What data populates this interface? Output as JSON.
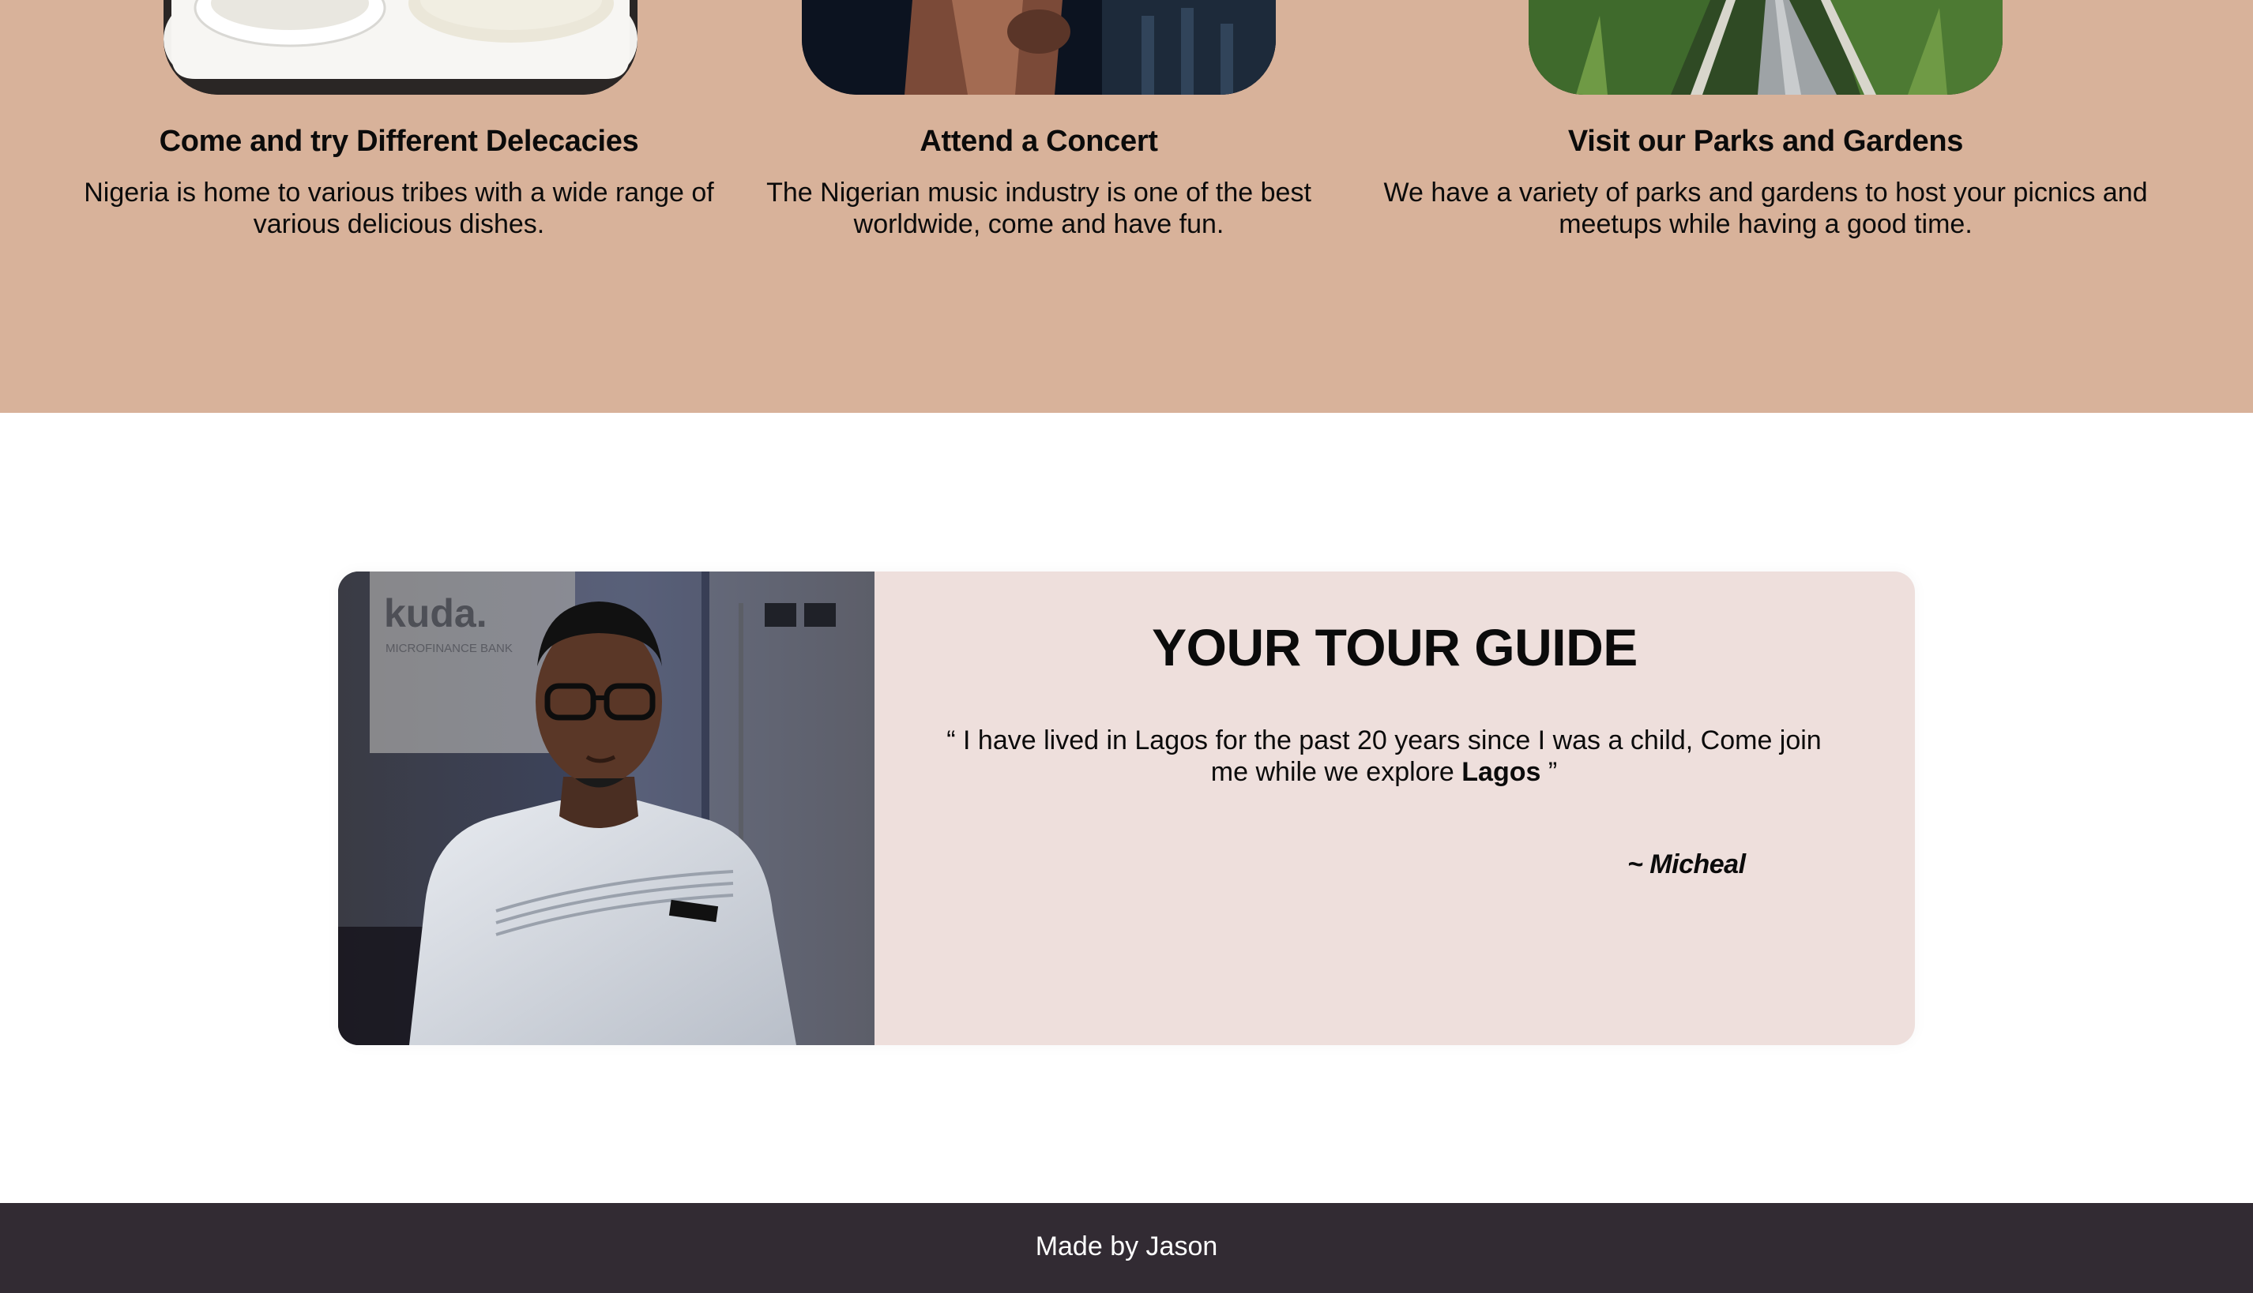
{
  "activities": [
    {
      "title": "Come and try Different Delecacies",
      "description": "Nigeria is home to various tribes with a wide range of various delicious dishes.",
      "image": "food-platter-photo"
    },
    {
      "title": "Attend a Concert",
      "description": "The Nigerian music industry is one of the best worldwide, come and have fun.",
      "image": "concert-performer-photo"
    },
    {
      "title": "Visit our Parks and Gardens",
      "description": "We have a variety of parks and gardens to host your picnics and meetups while having a good time.",
      "image": "park-canopy-walkway-photo"
    }
  ],
  "guide": {
    "title": "YOUR TOUR GUIDE",
    "quote_open": "“ ",
    "quote_text": "I have lived in Lagos for the past 20 years since I was a child, Come join me while we explore ",
    "quote_emphasis": "Lagos",
    "quote_close": " ”",
    "signature": "~ Micheal",
    "photo_text": "kuda.",
    "photo_subtext": "MICROFINANCE BANK"
  },
  "footer": {
    "text": "Made by Jason"
  },
  "colors": {
    "activities_bg": "#d8b29a",
    "guide_card_bg": "#eedfdc",
    "footer_bg": "#322b33"
  }
}
